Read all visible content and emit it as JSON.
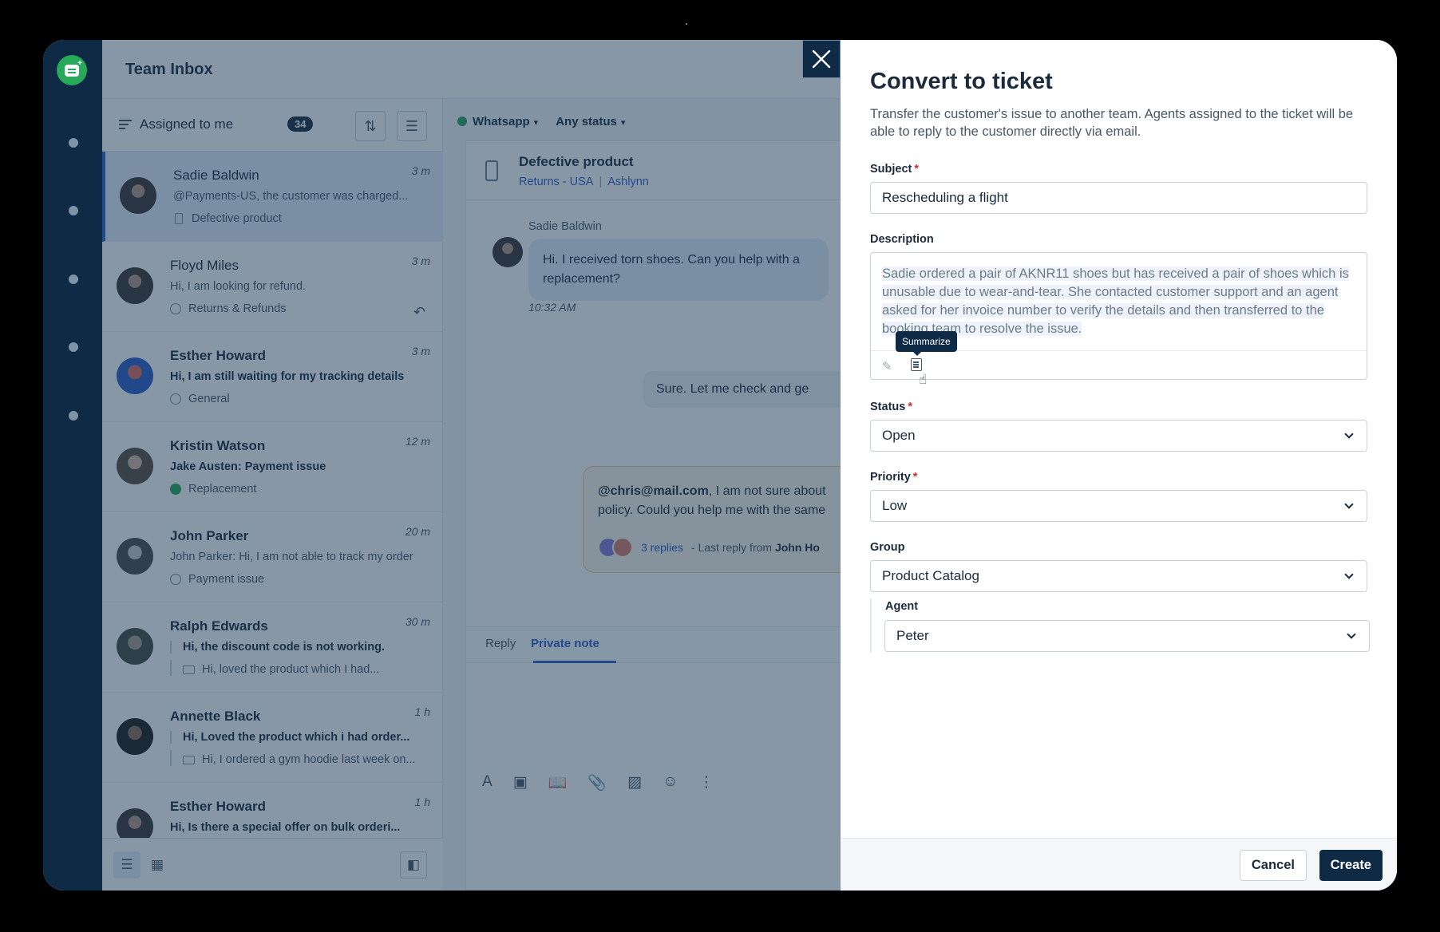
{
  "app": {
    "title": "Team Inbox"
  },
  "list": {
    "assigned_label": "Assigned to me",
    "assigned_count": "34",
    "conversations": [
      {
        "name": "Sadie Baldwin",
        "time": "3 m",
        "preview": "@Payments-US, the customer was charged...",
        "tag": "Defective product"
      },
      {
        "name": "Floyd Miles",
        "time": "3 m",
        "preview": "Hi, I am looking for refund.",
        "tag": "Returns & Refunds"
      },
      {
        "name": "Esther Howard",
        "time": "3 m",
        "preview": "Hi, I am still waiting for my tracking details",
        "tag": "General"
      },
      {
        "name": "Kristin Watson",
        "time": "12 m",
        "preview": "Jake Austen: Payment issue",
        "tag": "Replacement"
      },
      {
        "name": "John Parker",
        "time": "20 m",
        "preview": "John Parker: Hi, I am not able to track my order",
        "tag": "Payment issue"
      },
      {
        "name": "Ralph Edwards",
        "time": "30 m",
        "preview": "Hi, the discount code is not working.",
        "tag": "Hi, loved the product which I had..."
      },
      {
        "name": "Annette Black",
        "time": "1 h",
        "preview": "Hi, Loved the product which i had order...",
        "tag": "Hi, I ordered a gym hoodie last week on..."
      },
      {
        "name": "Esther Howard",
        "time": "1 h",
        "preview": "Hi, Is there a special offer on bulk orderi...",
        "tag": ""
      }
    ]
  },
  "chat": {
    "filter_channel": "Whatsapp",
    "filter_status": "Any status",
    "title": "Defective product",
    "group": "Returns - USA",
    "assignee": "Ashlynn",
    "sender": "Sadie Baldwin",
    "incoming_message": "Hi. I received torn shoes. Can you help with a replacement?",
    "incoming_time": "10:32 AM",
    "outgoing_message": "Sure. Let me check and ge",
    "note_mention": "@chris@mail.com",
    "note_text_1": ", I am not sure about",
    "note_text_2": "policy. Could you help me with the same",
    "note_replies": "3 replies",
    "note_last_reply_prefix": "- Last reply from",
    "note_last_reply_name": "John Ho",
    "tab_reply": "Reply",
    "tab_private_note": "Private note"
  },
  "drawer": {
    "title": "Convert to ticket",
    "description": "Transfer the customer's issue to another team. Agents assigned to the ticket will be able to reply to the customer directly via email.",
    "subject_label": "Subject",
    "subject_value": "Rescheduling a flight",
    "description_label": "Description",
    "description_value": "Sadie ordered a pair of AKNR11 shoes but has received a pair of shoes which is unusable due to wear-and-tear. She contacted customer support and an agent asked for her invoice number to verify the details and then transferred to the booking team to resolve the issue.",
    "summarize_tooltip": "Summarize",
    "status_label": "Status",
    "status_value": "Open",
    "priority_label": "Priority",
    "priority_value": "Low",
    "group_label": "Group",
    "group_value": "Product Catalog",
    "agent_label": "Agent",
    "agent_value": "Peter",
    "required_mark": "*",
    "cancel_label": "Cancel",
    "create_label": "Create"
  },
  "icons": {
    "close": "close-icon",
    "sort": "sort-icon",
    "filter": "filter-sliders-icon",
    "summarize": "document-icon"
  }
}
